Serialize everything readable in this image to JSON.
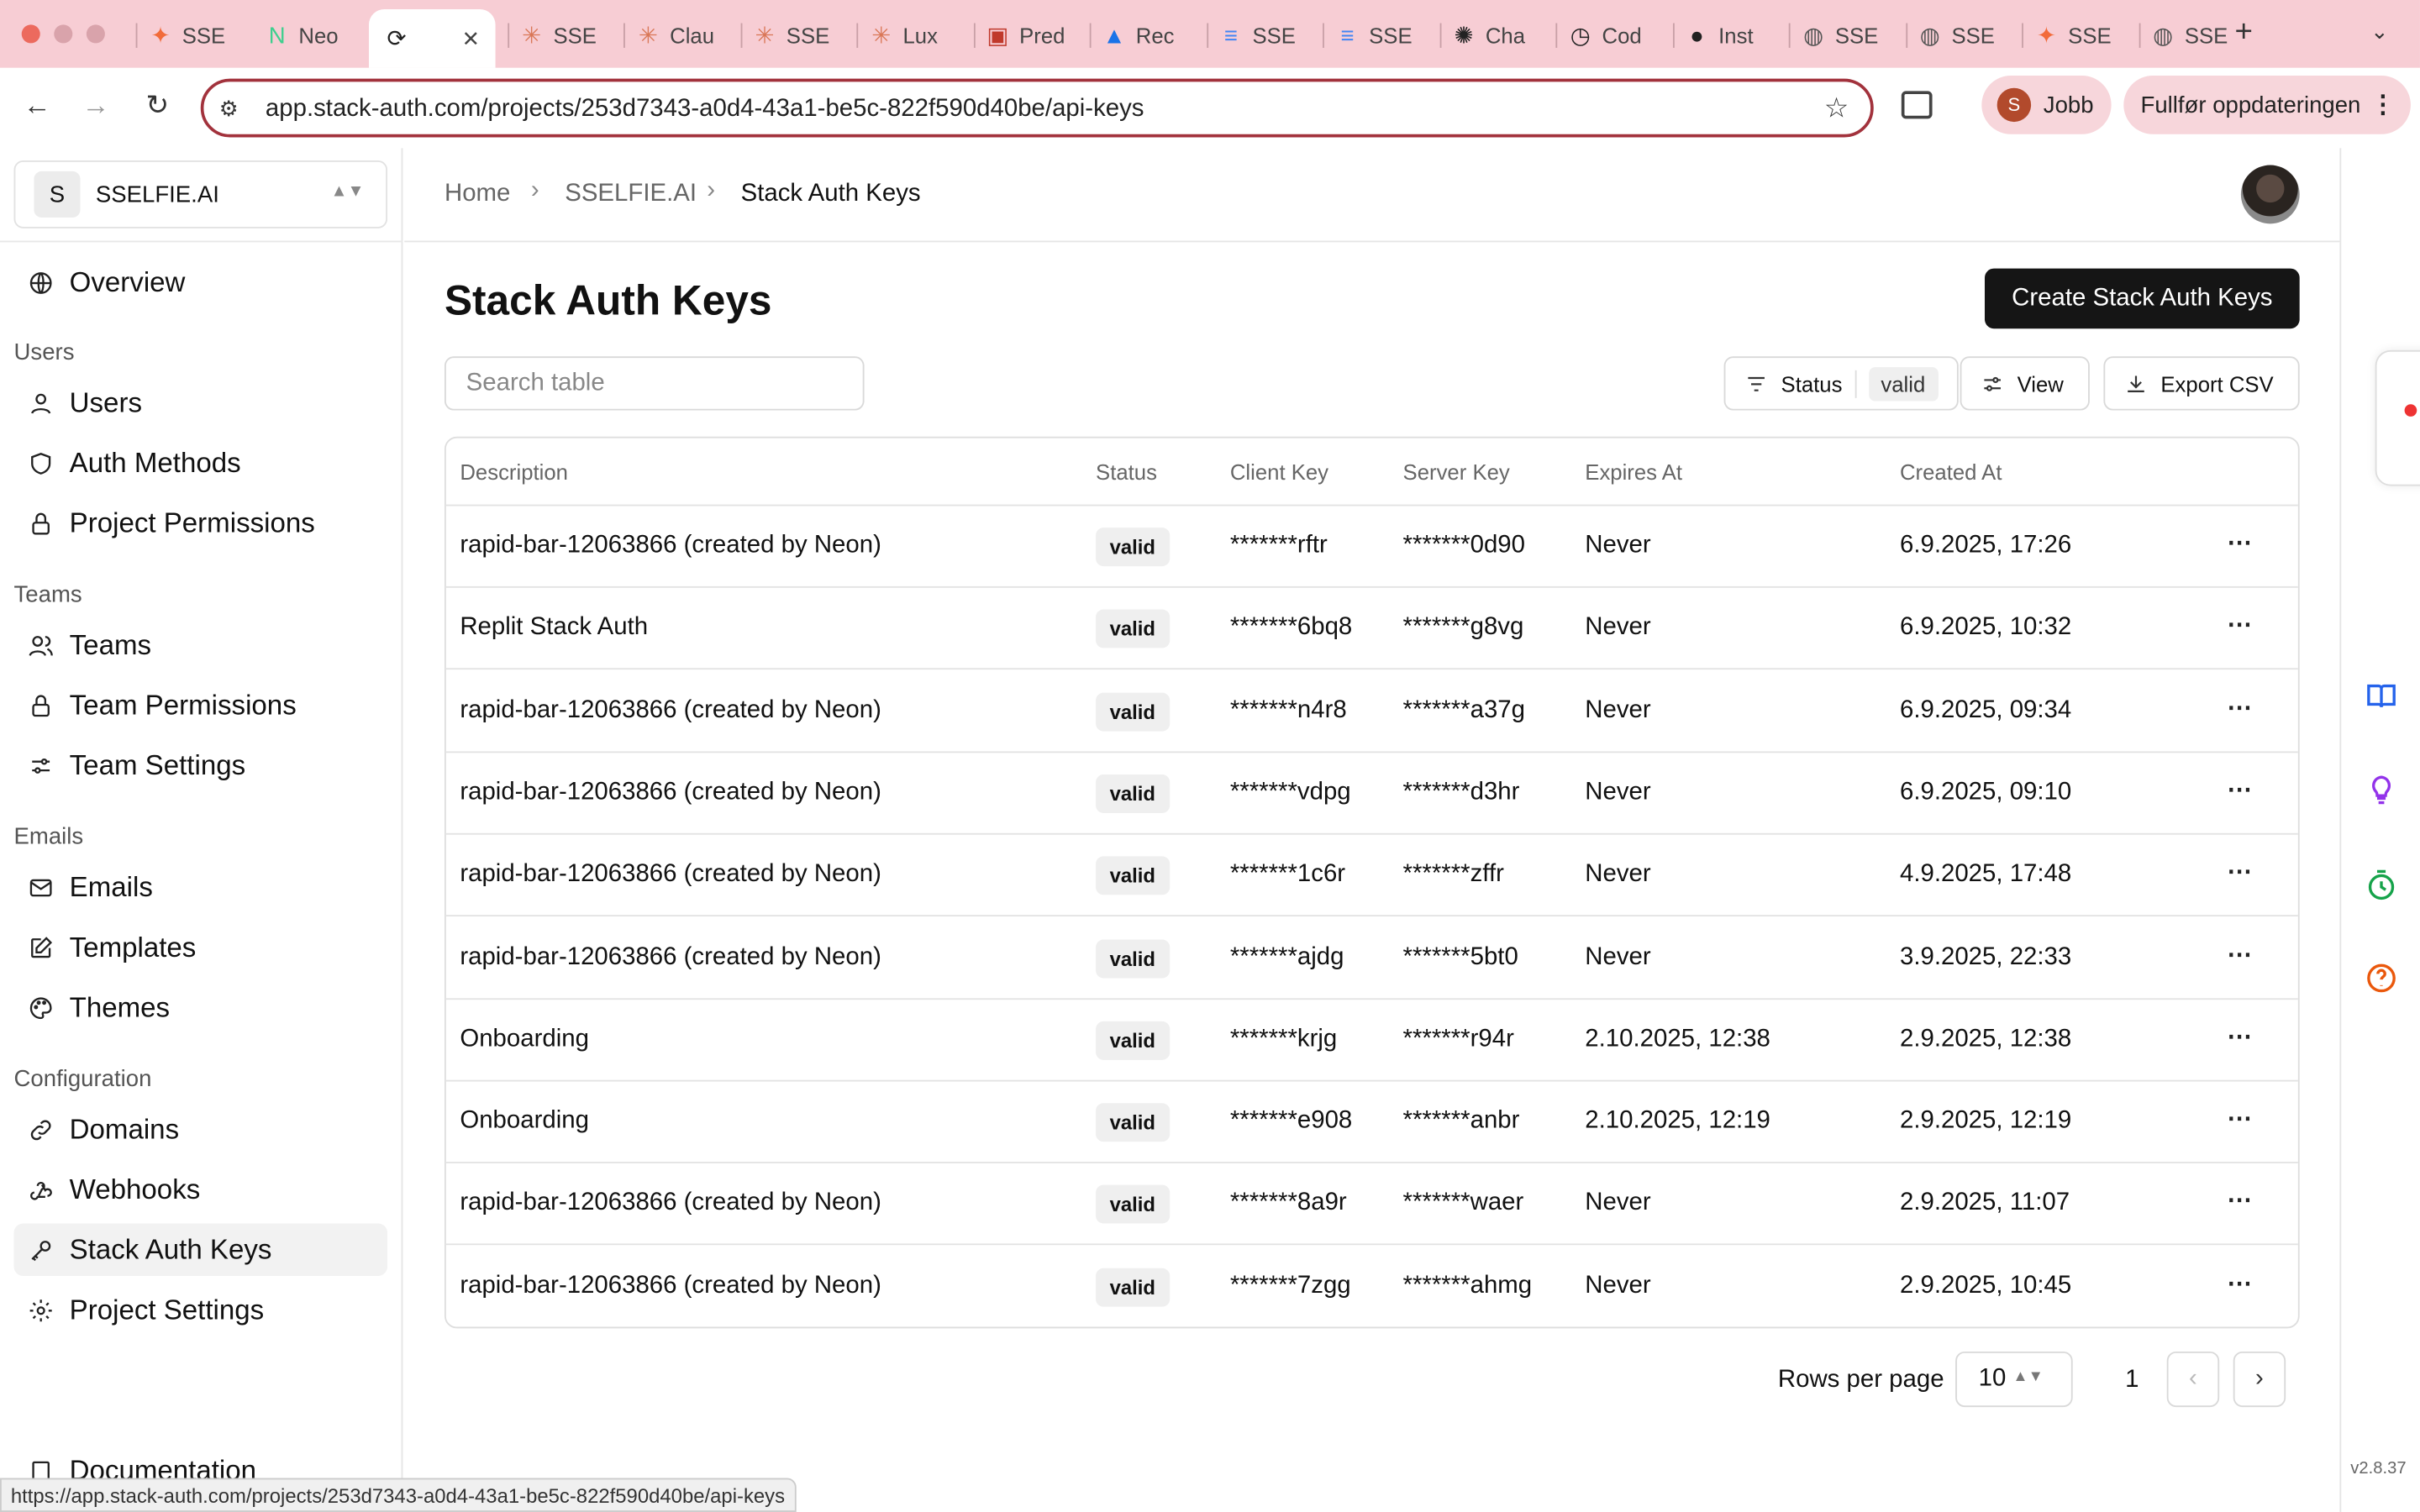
{
  "browser": {
    "tabs": [
      {
        "label": "SSE",
        "color": "#f26b3a",
        "glyph": "✦"
      },
      {
        "label": "Neo",
        "color": "#3ecf8e",
        "glyph": "N"
      },
      {
        "label": "",
        "color": "#222222",
        "glyph": "⟳"
      },
      {
        "label": "SSE",
        "color": "#d97757",
        "glyph": "✳"
      },
      {
        "label": "Clau",
        "color": "#d97757",
        "glyph": "✳"
      },
      {
        "label": "SSE",
        "color": "#d97757",
        "glyph": "✳"
      },
      {
        "label": "Lux",
        "color": "#d97757",
        "glyph": "✳"
      },
      {
        "label": "Pred",
        "color": "#c0392b",
        "glyph": "▣"
      },
      {
        "label": "Rec",
        "color": "#1a73e8",
        "glyph": "▲"
      },
      {
        "label": "SSE",
        "color": "#4285f4",
        "glyph": "≡"
      },
      {
        "label": "SSE",
        "color": "#4285f4",
        "glyph": "≡"
      },
      {
        "label": "Cha",
        "color": "#222222",
        "glyph": "✺"
      },
      {
        "label": "Cod",
        "color": "#222222",
        "glyph": "◷"
      },
      {
        "label": "Inst",
        "color": "#222222",
        "glyph": "●"
      },
      {
        "label": "SSE",
        "color": "#555555",
        "glyph": "◍"
      },
      {
        "label": "SSE",
        "color": "#555555",
        "glyph": "◍"
      },
      {
        "label": "SSE",
        "color": "#f26b3a",
        "glyph": "✦"
      },
      {
        "label": "SSE",
        "color": "#555555",
        "glyph": "◍"
      }
    ],
    "new_tab": "+",
    "url": "app.stack-auth.com/projects/253d7343-a0d4-43a1-be5c-822f590d40be/api-keys",
    "profile_initial": "S",
    "profile_name": "Jobb",
    "update_label": "Fullfør oppdateringen",
    "status_url": "https://app.stack-auth.com/projects/253d7343-a0d4-43a1-be5c-822f590d40be/api-keys"
  },
  "sidebar": {
    "project_initial": "S",
    "project_name": "SSELFIE.AI",
    "overview": "Overview",
    "sections": {
      "users": "Users",
      "teams": "Teams",
      "emails": "Emails",
      "configuration": "Configuration"
    },
    "items": {
      "users": "Users",
      "auth_methods": "Auth Methods",
      "project_permissions": "Project Permissions",
      "teams": "Teams",
      "team_permissions": "Team Permissions",
      "team_settings": "Team Settings",
      "emails": "Emails",
      "templates": "Templates",
      "themes": "Themes",
      "domains": "Domains",
      "webhooks": "Webhooks",
      "stack_auth_keys": "Stack Auth Keys",
      "project_settings": "Project Settings",
      "documentation": "Documentation"
    }
  },
  "header": {
    "breadcrumb": [
      "Home",
      "SSELFIE.AI",
      "Stack Auth Keys"
    ]
  },
  "page": {
    "title": "Stack Auth Keys",
    "create_button": "Create Stack Auth Keys",
    "search_placeholder": "Search table",
    "filter_label": "Status",
    "filter_value": "valid",
    "view_label": "View",
    "export_label": "Export CSV"
  },
  "table": {
    "columns": [
      "Description",
      "Status",
      "Client Key",
      "Server Key",
      "Expires At",
      "Created At"
    ],
    "rows": [
      {
        "description": "rapid-bar-12063866 (created by Neon)",
        "status": "valid",
        "client": "*******rftr",
        "server": "*******0d90",
        "expires": "Never",
        "created": "6.9.2025, 17:26"
      },
      {
        "description": "Replit Stack Auth",
        "status": "valid",
        "client": "*******6bq8",
        "server": "*******g8vg",
        "expires": "Never",
        "created": "6.9.2025, 10:32"
      },
      {
        "description": "rapid-bar-12063866 (created by Neon)",
        "status": "valid",
        "client": "*******n4r8",
        "server": "*******a37g",
        "expires": "Never",
        "created": "6.9.2025, 09:34"
      },
      {
        "description": "rapid-bar-12063866 (created by Neon)",
        "status": "valid",
        "client": "*******vdpg",
        "server": "*******d3hr",
        "expires": "Never",
        "created": "6.9.2025, 09:10"
      },
      {
        "description": "rapid-bar-12063866 (created by Neon)",
        "status": "valid",
        "client": "*******1c6r",
        "server": "*******zffr",
        "expires": "Never",
        "created": "4.9.2025, 17:48"
      },
      {
        "description": "rapid-bar-12063866 (created by Neon)",
        "status": "valid",
        "client": "*******ajdg",
        "server": "*******5bt0",
        "expires": "Never",
        "created": "3.9.2025, 22:33"
      },
      {
        "description": "Onboarding",
        "status": "valid",
        "client": "*******krjg",
        "server": "*******r94r",
        "expires": "2.10.2025, 12:38",
        "created": "2.9.2025, 12:38"
      },
      {
        "description": "Onboarding",
        "status": "valid",
        "client": "*******e908",
        "server": "*******anbr",
        "expires": "2.10.2025, 12:19",
        "created": "2.9.2025, 12:19"
      },
      {
        "description": "rapid-bar-12063866 (created by Neon)",
        "status": "valid",
        "client": "*******8a9r",
        "server": "*******waer",
        "expires": "Never",
        "created": "2.9.2025, 11:07"
      },
      {
        "description": "rapid-bar-12063866 (created by Neon)",
        "status": "valid",
        "client": "*******7zgg",
        "server": "*******ahmg",
        "expires": "Never",
        "created": "2.9.2025, 10:45"
      }
    ],
    "row_menu_glyph": "⋯"
  },
  "pagination": {
    "rows_per_page_label": "Rows per page",
    "rows_per_page_value": "10",
    "current_page": "1"
  },
  "version": "v2.8.37"
}
